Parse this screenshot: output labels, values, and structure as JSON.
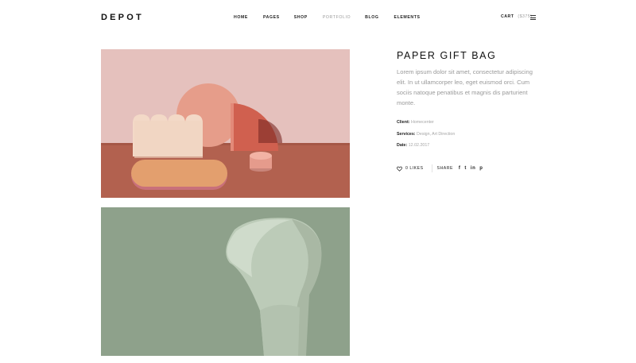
{
  "header": {
    "logo": "DEPOT",
    "nav": [
      "HOME",
      "PAGES",
      "SHOP",
      "PORTFOLIO",
      "BLOG",
      "ELEMENTS"
    ],
    "active_nav": "PORTFOLIO",
    "cart_label": "CART",
    "cart_count": "($375)"
  },
  "project": {
    "title": "PAPER GIFT BAG",
    "description": "Lorem ipsum dolor sit amet, consectetur adipiscing elit. In ut ullamcorper leo, eget euismod orci. Cum sociis natoque penatibus et magnis dis parturient monte.",
    "client_label": "Client:",
    "client_value": "Homecenter",
    "services_label": "Services:",
    "services_value": "Design, Art Direction",
    "date_label": "Date:",
    "date_value": "12.02.2017",
    "likes": "0 LIKES",
    "share_label": "SHARE",
    "share_icons": [
      "f",
      "t",
      "in",
      "p"
    ]
  },
  "images": {
    "first_icon": "paper-shapes-photo",
    "second_icon": "green-chair-photo"
  },
  "colors": {
    "accent_muted": "#9a9a9a",
    "wall_pink": "#e7c3bf",
    "table_terracotta": "#b4614f",
    "sage_green": "#8fa38b"
  }
}
